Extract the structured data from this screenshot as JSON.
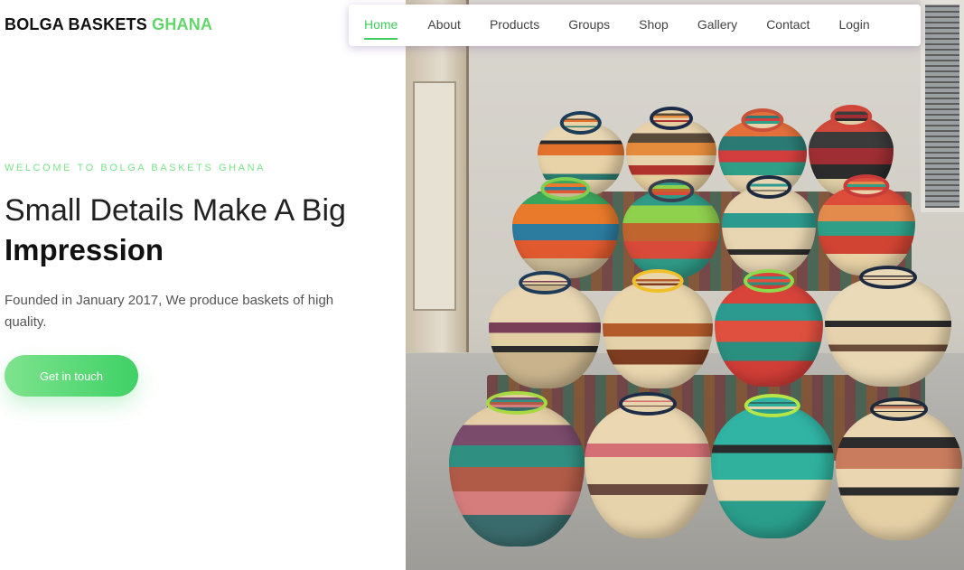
{
  "brand": {
    "name": "BOLGA BASKETS",
    "accent": "GHANA"
  },
  "nav": {
    "items": [
      {
        "label": "Home",
        "active": true
      },
      {
        "label": "About"
      },
      {
        "label": "Products"
      },
      {
        "label": "Groups"
      },
      {
        "label": "Shop"
      },
      {
        "label": "Gallery"
      },
      {
        "label": "Contact"
      },
      {
        "label": "Login"
      }
    ]
  },
  "hero": {
    "eyebrow": "WELCOME TO BOLGA BASKETS GHANA",
    "headline": "Small Details Make A Big",
    "headline_bold": "Impression",
    "description": "Founded in January 2017, We produce baskets of high quality.",
    "cta_label": "Get in touch",
    "image_icon": "baskets-photo"
  },
  "colors": {
    "accent": "#63d66b",
    "nav_active": "#3fcf5e",
    "cta_gradient_start": "#7ee38d",
    "cta_gradient_end": "#3fd166"
  }
}
